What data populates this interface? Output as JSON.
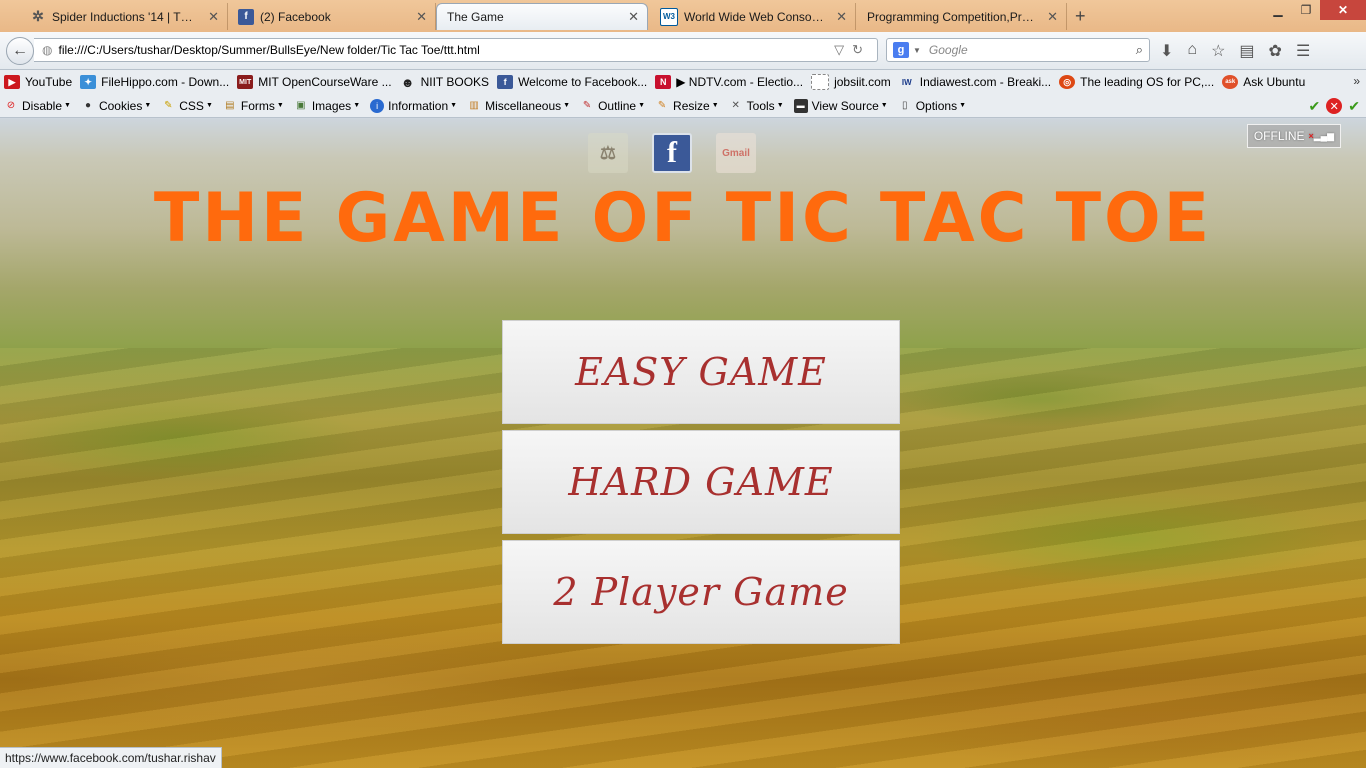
{
  "tabs": [
    {
      "title": "Spider Inductions '14 | The ...",
      "icon": "spider-icon",
      "active": false
    },
    {
      "title": "(2) Facebook",
      "icon": "facebook-icon",
      "active": false
    },
    {
      "title": "The Game",
      "icon": "",
      "active": true
    },
    {
      "title": "World Wide Web Consorti...",
      "icon": "w3c-icon",
      "active": false
    },
    {
      "title": "Programming Competition,Pro...",
      "icon": "",
      "active": false
    }
  ],
  "url": "file:///C:/Users/tushar/Desktop/Summer/BullsEye/New folder/Tic Tac Toe/ttt.html",
  "search": {
    "placeholder": "Google",
    "engine_logo": "g"
  },
  "bookmarks": [
    {
      "label": "YouTube",
      "icon": "youtube-icon",
      "color": "#cc181e",
      "glyph": "▶"
    },
    {
      "label": "FileHippo.com - Down...",
      "icon": "filehippo-icon",
      "color": "#3a8fd8",
      "glyph": "✦"
    },
    {
      "label": "MIT OpenCourseWare ...",
      "icon": "mit-icon",
      "color": "#8a1c1c",
      "glyph": "MIT"
    },
    {
      "label": "NIIT BOOKS",
      "icon": "linux-penguin-icon",
      "color": "#222222",
      "glyph": "☻"
    },
    {
      "label": "Welcome to Facebook...",
      "icon": "facebook-icon",
      "color": "#3b5998",
      "glyph": "f"
    },
    {
      "label": "▶ NDTV.com - Electio...",
      "icon": "ndtv-icon",
      "color": "#c8102e",
      "glyph": "N"
    },
    {
      "label": "jobsiit.com",
      "icon": "page-icon",
      "color": "#ffffff",
      "glyph": " "
    },
    {
      "label": "Indiawest.com - Breaki...",
      "icon": "indiawest-icon",
      "color": "#1a3a8a",
      "glyph": "IW"
    },
    {
      "label": "The leading OS for PC,...",
      "icon": "ubuntu-icon",
      "color": "#dd4814",
      "glyph": "◎"
    },
    {
      "label": "Ask Ubuntu",
      "icon": "askubuntu-icon",
      "color": "#e0502a",
      "glyph": "ask"
    }
  ],
  "dev_toolbar": [
    {
      "label": "Disable",
      "icon": "disable-icon",
      "glyph": "⊘",
      "color": "#d22"
    },
    {
      "label": "Cookies",
      "icon": "cookies-icon",
      "glyph": "●",
      "color": "#333"
    },
    {
      "label": "CSS",
      "icon": "css-icon",
      "glyph": "✎",
      "color": "#c9a000"
    },
    {
      "label": "Forms",
      "icon": "forms-icon",
      "glyph": "▤",
      "color": "#b07b20"
    },
    {
      "label": "Images",
      "icon": "images-icon",
      "glyph": "▣",
      "color": "#4a7a3a"
    },
    {
      "label": "Information",
      "icon": "information-icon",
      "glyph": "i",
      "color": "#2a6ad0"
    },
    {
      "label": "Miscellaneous",
      "icon": "miscellaneous-icon",
      "glyph": "▥",
      "color": "#c07a20"
    },
    {
      "label": "Outline",
      "icon": "outline-icon",
      "glyph": "✎",
      "color": "#c03030"
    },
    {
      "label": "Resize",
      "icon": "resize-icon",
      "glyph": "✎",
      "color": "#d08020"
    },
    {
      "label": "Tools",
      "icon": "tools-icon",
      "glyph": "✕",
      "color": "#555"
    },
    {
      "label": "View Source",
      "icon": "view-source-icon",
      "glyph": "▬",
      "color": "#333"
    },
    {
      "label": "Options",
      "icon": "options-icon",
      "glyph": "▯",
      "color": "#444"
    }
  ],
  "page": {
    "title": "THE GAME OF TIC TAC TOE",
    "offline_label": "OFFLINE",
    "social": [
      {
        "icon": "emblem-icon",
        "glyph": "⚖"
      },
      {
        "icon": "facebook-icon",
        "glyph": "f"
      },
      {
        "icon": "gmail-icon",
        "glyph": "Gmail"
      }
    ],
    "buttons": [
      "EASY GAME",
      "HARD GAME",
      "2 Player Game"
    ]
  },
  "status_url": "https://www.facebook.com/tushar.rishav",
  "colors": {
    "title": "#ff6a0d",
    "button_text": "#a8302f",
    "tabbar": "#e9b887"
  }
}
